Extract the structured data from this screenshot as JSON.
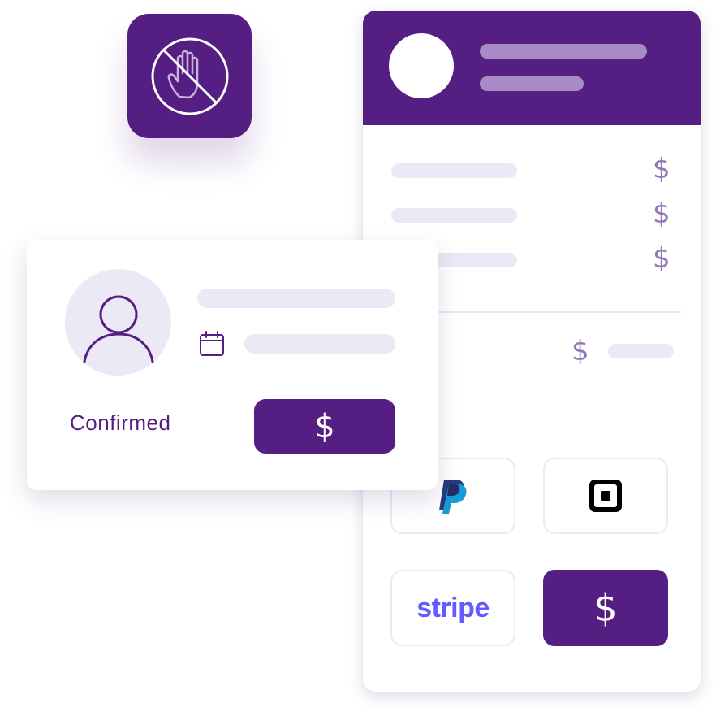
{
  "icons": {
    "no_touch": "no-touch-hand-icon",
    "user": "user-icon",
    "calendar": "calendar-icon",
    "paypal": "paypal-icon",
    "square": "square-icon"
  },
  "colors": {
    "brand_purple": "#551e82",
    "light_purple": "#ede8f5",
    "header_line": "#a88bc6",
    "dollar_light": "#9378b6",
    "stripe_blue": "#635bff"
  },
  "invoice": {
    "line_items": [
      {
        "currency": "$"
      },
      {
        "currency": "$"
      },
      {
        "currency": "$"
      }
    ],
    "total": {
      "currency": "$"
    },
    "payment_options": {
      "stripe_label": "stripe",
      "cash_symbol": "$"
    }
  },
  "booking_card": {
    "status": "Confirmed",
    "pay_symbol": "$"
  }
}
